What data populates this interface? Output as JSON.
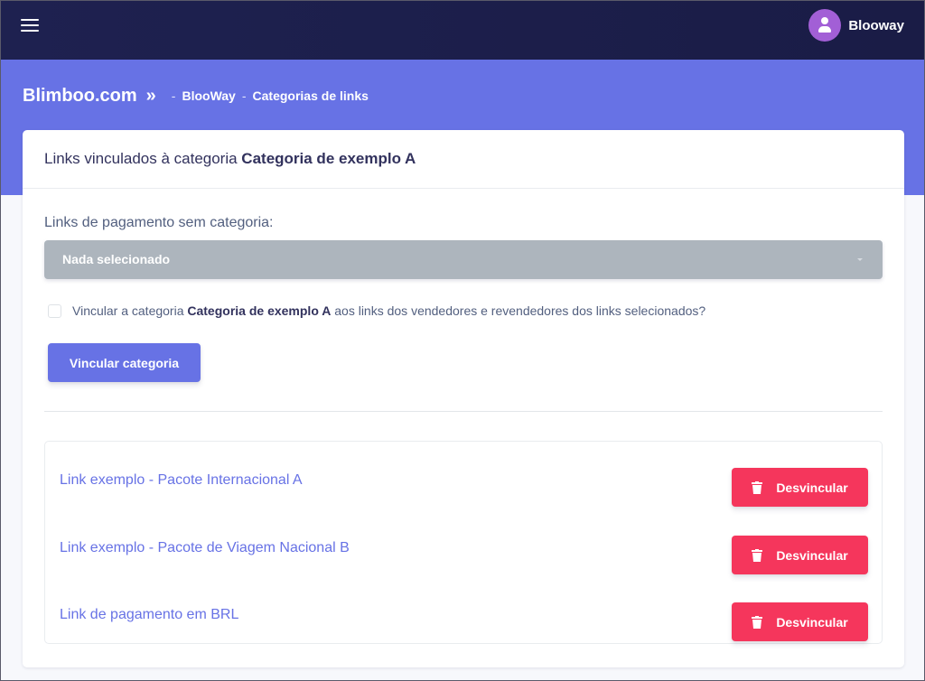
{
  "topbar": {
    "menu_icon": "hamburger-menu-icon",
    "user": {
      "name": "Blooway",
      "avatar_icon": "user-icon"
    }
  },
  "breadcrumb": {
    "brand": "Blimboo.com",
    "chevron": "»",
    "separator": "-",
    "items": [
      {
        "label": "BlooWay"
      },
      {
        "label": "Categorias de links"
      }
    ]
  },
  "card": {
    "title_prefix": "Links vinculados à categoria ",
    "category_name": "Categoria de exemplo A"
  },
  "form": {
    "select_label": "Links de pagamento sem categoria:",
    "select_value": "Nada selecionado",
    "checkbox": {
      "checked": false,
      "text_before": "Vincular a categoria ",
      "category_name": "Categoria de exemplo A",
      "text_after": " aos links dos vendedores e revendedores dos links selecionados?"
    },
    "submit_label": "Vincular categoria"
  },
  "links": [
    {
      "name": "Link exemplo - Pacote Internacional A",
      "action_label": "Desvincular"
    },
    {
      "name": "Link exemplo - Pacote de Viagem Nacional B",
      "action_label": "Desvincular"
    },
    {
      "name": "Link de pagamento em BRL",
      "action_label": "Desvincular"
    }
  ],
  "colors": {
    "topbar": "#1e2150",
    "primary": "#6772e5",
    "danger": "#f5365c",
    "select_bg": "#adb5bd",
    "avatar": "#a25fd6"
  }
}
